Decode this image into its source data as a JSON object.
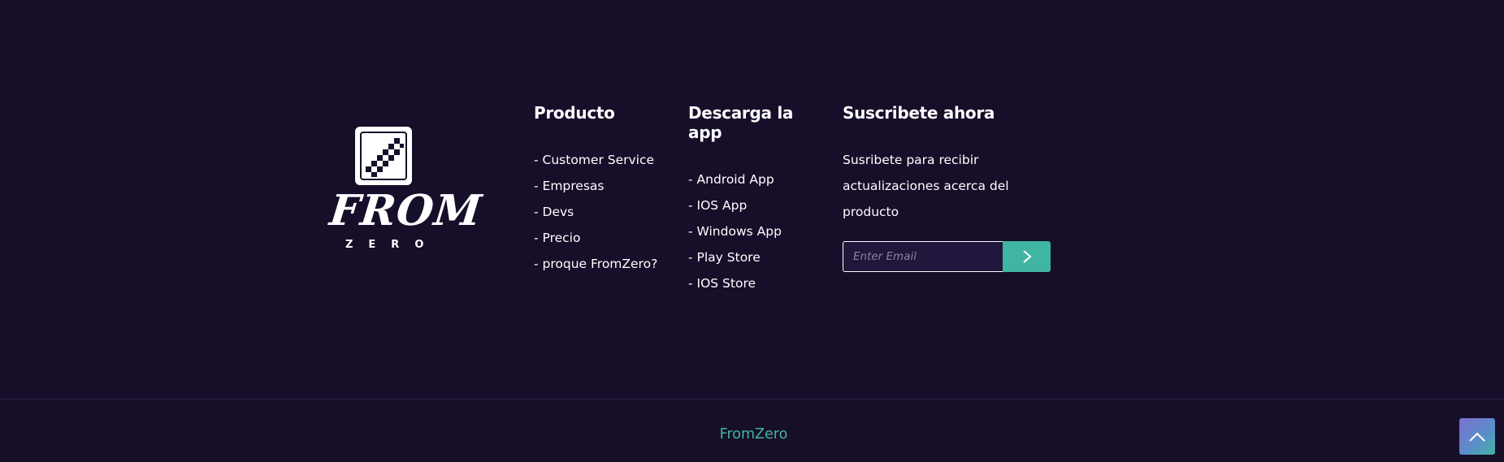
{
  "logo": {
    "word": "FROM",
    "sub": "ZERO"
  },
  "product": {
    "title": "Producto",
    "items": [
      "- Customer Service",
      "- Empresas",
      "- Devs",
      "- Precio",
      "- proque FromZero?"
    ]
  },
  "app": {
    "title": "Descarga la app",
    "items": [
      "- Android App",
      "- IOS App",
      "- Windows App",
      "- Play Store",
      "- IOS Store"
    ]
  },
  "subscribe": {
    "title": "Suscribete ahora",
    "text": "Susribete para recibir actualizaciones acerca del producto",
    "placeholder": "Enter Email",
    "button_icon": "chevron-right-icon"
  },
  "bottom": {
    "brand": "FromZero",
    "top_icon": "chevron-up-icon"
  },
  "colors": {
    "background": "#170e2a",
    "accent": "#40b5a3",
    "text": "#ffffff"
  }
}
